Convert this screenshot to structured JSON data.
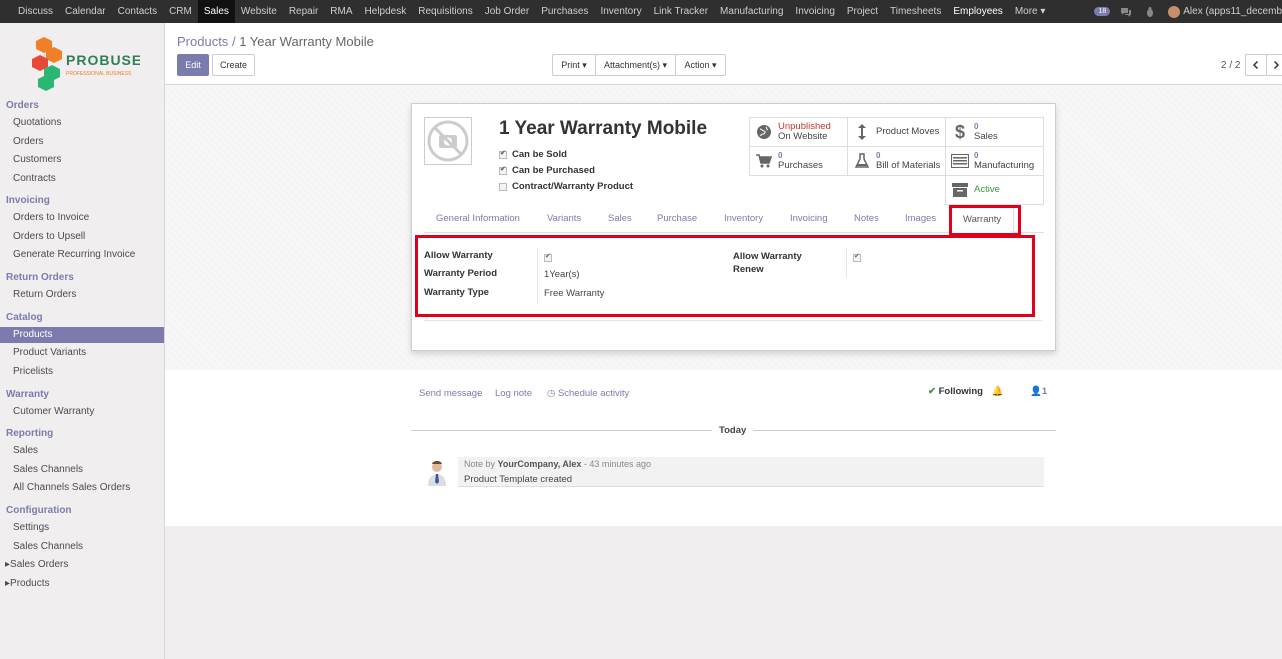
{
  "topnav": {
    "items": [
      "Discuss",
      "Calendar",
      "Contacts",
      "CRM",
      "Sales",
      "Website",
      "Repair",
      "RMA",
      "Helpdesk",
      "Requisitions",
      "Job Order",
      "Purchases",
      "Inventory",
      "Link Tracker",
      "Manufacturing",
      "Invoicing",
      "Project",
      "Timesheets",
      "Employees",
      "More"
    ],
    "active": "Sales",
    "badge": "18",
    "user": "Alex (apps11_decemb"
  },
  "logo": {
    "name": "PROBUSE",
    "tagline": "PROFESSIONAL BUSINESS"
  },
  "sidebar": {
    "orders_title": "Orders",
    "orders": [
      "Quotations",
      "Orders",
      "Customers",
      "Contracts"
    ],
    "invoicing_title": "Invoicing",
    "invoicing": [
      "Orders to Invoice",
      "Orders to Upsell",
      "Generate Recurring Invoice"
    ],
    "return_title": "Return Orders",
    "return": [
      "Return Orders"
    ],
    "catalog_title": "Catalog",
    "catalog": [
      "Products",
      "Product Variants",
      "Pricelists"
    ],
    "warranty_title": "Warranty",
    "warranty": [
      "Cutomer Warranty"
    ],
    "reporting_title": "Reporting",
    "reporting": [
      "Sales",
      "Sales Channels",
      "All Channels Sales Orders"
    ],
    "config_title": "Configuration",
    "config": [
      "Settings",
      "Sales Channels"
    ],
    "tree": [
      "Sales Orders",
      "Products"
    ]
  },
  "breadcrumb": {
    "parent": "Products",
    "sep": "/",
    "current": "1 Year Warranty Mobile"
  },
  "buttons": {
    "edit": "Edit",
    "create": "Create",
    "print": "Print",
    "attachments": "Attachment(s)",
    "action": "Action"
  },
  "pager": {
    "value": "2 / 2"
  },
  "product": {
    "name": "1 Year Warranty Mobile",
    "can_be_sold": "Can be Sold",
    "can_be_purchased": "Can be Purchased",
    "contract_warranty": "Contract/Warranty Product"
  },
  "stats": {
    "website_status": "Unpublished",
    "website_label": "On Website",
    "moves": "Product Moves",
    "sales_count": "0",
    "sales_label": "Sales",
    "purchases_count": "0",
    "purchases_label": "Purchases",
    "bom_count": "0",
    "bom_label": "Bill of Materials",
    "mfg_count": "0",
    "mfg_label": "Manufacturing",
    "active_label": "Active"
  },
  "tabs": [
    "General Information",
    "Variants",
    "Sales",
    "Purchase",
    "Inventory",
    "Invoicing",
    "Notes",
    "Images",
    "Warranty"
  ],
  "warranty": {
    "allow_label": "Allow Warranty",
    "period_label": "Warranty Period",
    "period_value": "1Year(s)",
    "type_label": "Warranty Type",
    "type_value": "Free Warranty",
    "renew_label_1": "Allow Warranty",
    "renew_label_2": "Renew"
  },
  "chatter": {
    "send": "Send message",
    "log": "Log note",
    "schedule": "Schedule activity",
    "following": "Following",
    "followers": "1",
    "today": "Today",
    "note_prefix": "Note by",
    "author": "YourCompany, Alex",
    "time": "- 43 minutes ago",
    "body": "Product Template created"
  },
  "colors": {
    "accent": "#7c7bad",
    "topbar": "#2f2f2f",
    "highlight": "#e0001b",
    "unpublished": "#c0392b",
    "active": "#3c9a3c"
  }
}
